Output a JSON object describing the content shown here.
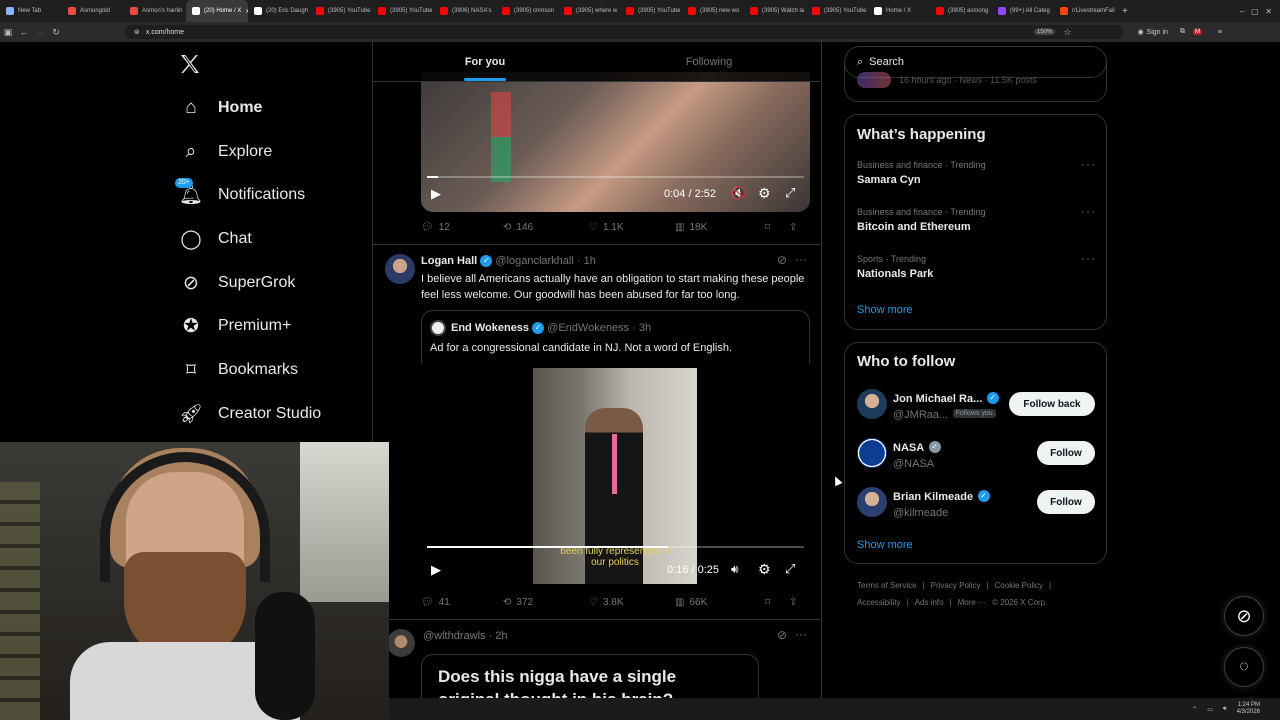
{
  "browser": {
    "tabs": [
      {
        "label": "New Tab",
        "color": "#8ab4f8"
      },
      {
        "label": "Asmongold",
        "color": "#e84c3d"
      },
      {
        "label": "Asmon's hairlin",
        "color": "#e84c3d"
      },
      {
        "label": "(20) Home / X",
        "color": "#ffffff",
        "active": true
      },
      {
        "label": "(20) Eric Daugh",
        "color": "#ffffff"
      },
      {
        "label": "(3905) YouTube",
        "color": "#ff0000"
      },
      {
        "label": "(3905) YouTube",
        "color": "#ff0000"
      },
      {
        "label": "(3906) NASA's",
        "color": "#ff0000"
      },
      {
        "label": "(3905) crimson",
        "color": "#ff0000"
      },
      {
        "label": "(3905) where w",
        "color": "#ff0000"
      },
      {
        "label": "(3905) YouTube",
        "color": "#ff0000"
      },
      {
        "label": "(3905) new wo",
        "color": "#ff0000"
      },
      {
        "label": "(3905) Watch la",
        "color": "#ff0000"
      },
      {
        "label": "(3905) YouTube",
        "color": "#ff0000"
      },
      {
        "label": "Home / X",
        "color": "#ffffff"
      },
      {
        "label": "(3905) asmong",
        "color": "#ff0000"
      },
      {
        "label": "(99+) All Categ",
        "color": "#9146ff"
      },
      {
        "label": "r/LivestreamFail",
        "color": "#ff4500"
      }
    ],
    "url": "x.com/home",
    "zoom": "150%",
    "sign_in": "Sign in"
  },
  "nav": {
    "logo": "X",
    "items": [
      {
        "label": "Home",
        "icon": "home-icon",
        "active": true
      },
      {
        "label": "Explore",
        "icon": "search-icon"
      },
      {
        "label": "Notifications",
        "icon": "bell-icon",
        "badge": "20+"
      },
      {
        "label": "Chat",
        "icon": "chat-icon"
      },
      {
        "label": "SuperGrok",
        "icon": "grok-icon"
      },
      {
        "label": "Premium+",
        "icon": "verified-icon"
      },
      {
        "label": "Bookmarks",
        "icon": "bookmark-icon"
      },
      {
        "label": "Creator Studio",
        "icon": "rocket-icon"
      }
    ]
  },
  "feed": {
    "tabs": [
      {
        "label": "For you",
        "active": true
      },
      {
        "label": "Following"
      }
    ],
    "post1": {
      "video_time": "0:04 / 2:52",
      "replies": "12",
      "reposts": "146",
      "likes": "1.1K",
      "views": "18K"
    },
    "post2": {
      "name": "Logan Hall",
      "handle": "@loganclarkhall",
      "time": "· 1h",
      "text": "I believe all Americans actually have an obligation to start making these people feel less welcome. Our goodwill has been abused for far too long.",
      "quote": {
        "name": "End Wokeness",
        "handle": "@EndWokeness",
        "time": "· 3h",
        "text": "Ad for a congressional candidate in NJ. Not a word of English.",
        "caption": "been fully represented in our politics",
        "video_time": "0:16 / 0:25",
        "progress": 0.64
      },
      "replies": "41",
      "reposts": "372",
      "likes": "3.8K",
      "views": "66K"
    },
    "post3": {
      "handle": "@wlthdrawls",
      "time": "· 2h",
      "text": "Does this nigga have a single original thought in his brain?"
    }
  },
  "right": {
    "search_placeholder": "Search",
    "top_meta": "16 hours ago · News · 11.5K posts",
    "happening_title": "What’s happening",
    "trends": [
      {
        "meta": "Business and finance · Trending",
        "name": "Samara Cyn"
      },
      {
        "meta": "Business and finance · Trending",
        "name": "Bitcoin and Ethereum"
      },
      {
        "meta": "Sports · Trending",
        "name": "Nationals Park"
      }
    ],
    "show_more": "Show more",
    "who_title": "Who to follow",
    "follow": [
      {
        "name": "Jon Michael Ra...",
        "handle": "@JMRaa...",
        "follows_you": "Follows you",
        "button": "Follow back"
      },
      {
        "name": "NASA",
        "handle": "@NASA",
        "button": "Follow"
      },
      {
        "name": "Brian Kilmeade",
        "handle": "@kilmeade",
        "button": "Follow"
      }
    ],
    "footer": [
      "Terms of Service",
      "Privacy Policy",
      "Cookie Policy",
      "Accessibility",
      "Ads info",
      "More ···",
      "© 2026 X Corp."
    ]
  },
  "taskbar": {
    "time": "1:24 PM",
    "date": "4/3/2026"
  },
  "colors": {
    "accent": "#1d9bf0",
    "border": "#2f3336",
    "muted": "#71767b"
  }
}
